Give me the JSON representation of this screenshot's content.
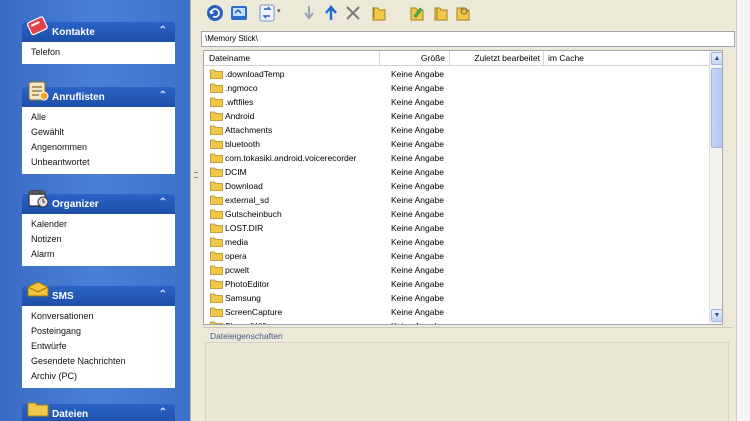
{
  "sidebar": {
    "groups": [
      {
        "title": "Kontakte",
        "icon": "contacts-book-icon",
        "items": [
          "Telefon"
        ]
      },
      {
        "title": "Anruflisten",
        "icon": "call-list-icon",
        "items": [
          "Alle",
          "Gewählt",
          "Angenommen",
          "Unbeantwortet"
        ]
      },
      {
        "title": "Organizer",
        "icon": "organizer-icon",
        "items": [
          "Kalender",
          "Notizen",
          "Alarm"
        ]
      },
      {
        "title": "SMS",
        "icon": "sms-envelope-icon",
        "items": [
          "Konversationen",
          "Posteingang",
          "Entwürfe",
          "Gesendete Nachrichten",
          "Archiv (PC)"
        ]
      },
      {
        "title": "Dateien",
        "icon": "folder-icon",
        "items": []
      }
    ],
    "collapse_glyph": "⌃"
  },
  "toolbar": {
    "buttons": [
      "refresh-icon",
      "sync-icon",
      "transfer-icon",
      "arrow-down-icon",
      "arrow-up-icon",
      "delete-icon",
      "folder-copy-icon",
      "edit-icon",
      "new-folder-icon",
      "rename-icon"
    ]
  },
  "path": "\\Memory Stick\\",
  "columns": {
    "name": "Dateiname",
    "size": "Größe",
    "modified": "Zuletzt bearbeitet",
    "cache": "im Cache"
  },
  "files": [
    {
      "name": ".downloadTemp",
      "size": "Keine Angabe"
    },
    {
      "name": ".ngmoco",
      "size": "Keine Angabe"
    },
    {
      "name": ".wftfiles",
      "size": "Keine Angabe"
    },
    {
      "name": "Android",
      "size": "Keine Angabe"
    },
    {
      "name": "Attachments",
      "size": "Keine Angabe"
    },
    {
      "name": "bluetooth",
      "size": "Keine Angabe"
    },
    {
      "name": "com.tokasiki.android.voicerecorder",
      "size": "Keine Angabe"
    },
    {
      "name": "DCIM",
      "size": "Keine Angabe"
    },
    {
      "name": "Download",
      "size": "Keine Angabe"
    },
    {
      "name": "external_sd",
      "size": "Keine Angabe"
    },
    {
      "name": "Gutscheinbuch",
      "size": "Keine Angabe"
    },
    {
      "name": "LOST.DIR",
      "size": "Keine Angabe"
    },
    {
      "name": "media",
      "size": "Keine Angabe"
    },
    {
      "name": "opera",
      "size": "Keine Angabe"
    },
    {
      "name": "pcwelt",
      "size": "Keine Angabe"
    },
    {
      "name": "PhotoEditor",
      "size": "Keine Angabe"
    },
    {
      "name": "Samsung",
      "size": "Keine Angabe"
    },
    {
      "name": "ScreenCapture",
      "size": "Keine Angabe"
    },
    {
      "name": "SharedWifi",
      "size": "Keine Angabe"
    }
  ],
  "properties": {
    "label": "Dateieigenschaften"
  },
  "colors": {
    "sidebar_bg": "#3d72cb",
    "group_header": "#1d4fa8",
    "panel_bg": "#ece9d8",
    "folder": "#f2c84b"
  }
}
